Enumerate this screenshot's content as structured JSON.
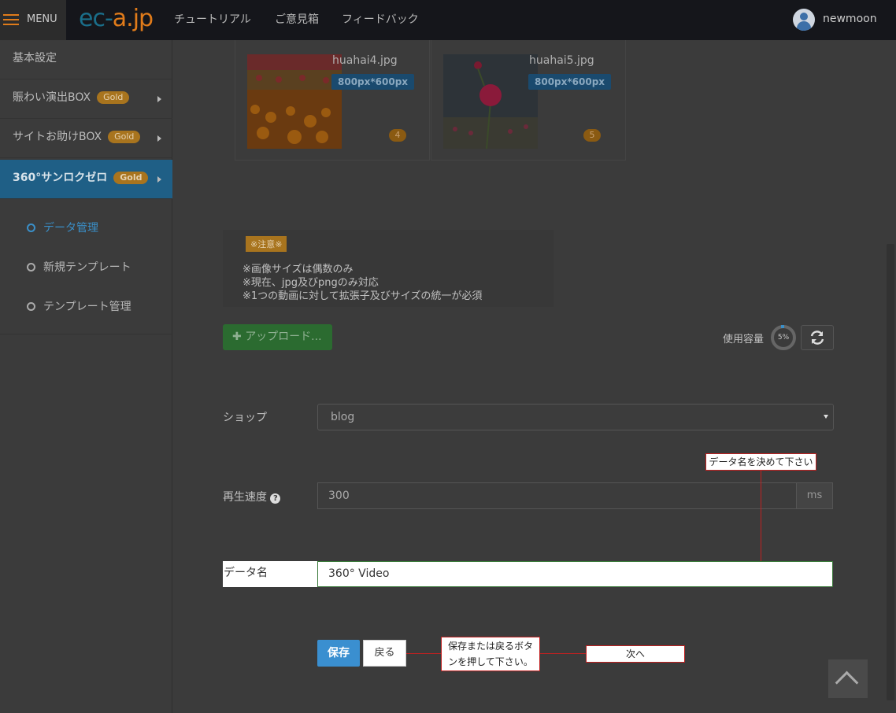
{
  "header": {
    "menu_label": "MENU",
    "logo_text_a": "ec-",
    "logo_text_b": "a",
    "logo_text_c": ".jp",
    "nav": [
      "チュートリアル",
      "ご意見箱",
      "フィードバック"
    ],
    "user_name": "newmoon"
  },
  "sidebar": {
    "items": [
      {
        "label": "基本設定",
        "badge": ""
      },
      {
        "label": "賑わい演出BOX",
        "badge": "Gold"
      },
      {
        "label": "サイトお助けBOX",
        "badge": "Gold"
      },
      {
        "label": "360°サンロクゼロ",
        "badge": "Gold"
      }
    ],
    "sub_items": [
      "データ管理",
      "新規テンプレート",
      "テンプレート管理"
    ]
  },
  "images": [
    {
      "file": "huahai4.jpg",
      "size": "800px*600px",
      "num": "4"
    },
    {
      "file": "huahai5.jpg",
      "size": "800px*600px",
      "num": "5"
    }
  ],
  "notice": {
    "badge": "※注意※",
    "lines": [
      "※画像サイズは偶数のみ",
      "※現在、jpg及びpngのみ対応",
      "※1つの動画に対して拡張子及びサイズの統一が必須"
    ]
  },
  "upload": {
    "label": "アップロード...",
    "usage_label": "使用容量",
    "usage_value": "5%"
  },
  "form": {
    "shop_label": "ショップ",
    "shop_value": "blog",
    "speed_label": "再生速度",
    "speed_value": "300",
    "speed_unit": "ms",
    "name_label": "データ名",
    "name_value": "360° Video",
    "save_label": "保存",
    "back_label": "戻る"
  },
  "annotations": {
    "name_note": "データ名を決めて下さい",
    "button_note_1": "保存または戻るボタ",
    "button_note_2": "ンを押して下さい。",
    "next_note": "次へ"
  },
  "colors": {
    "accent": "#3a8fd0",
    "active_sidebar": "#1f5f86",
    "badge": "#a8741e",
    "annotation": "#c02020"
  }
}
